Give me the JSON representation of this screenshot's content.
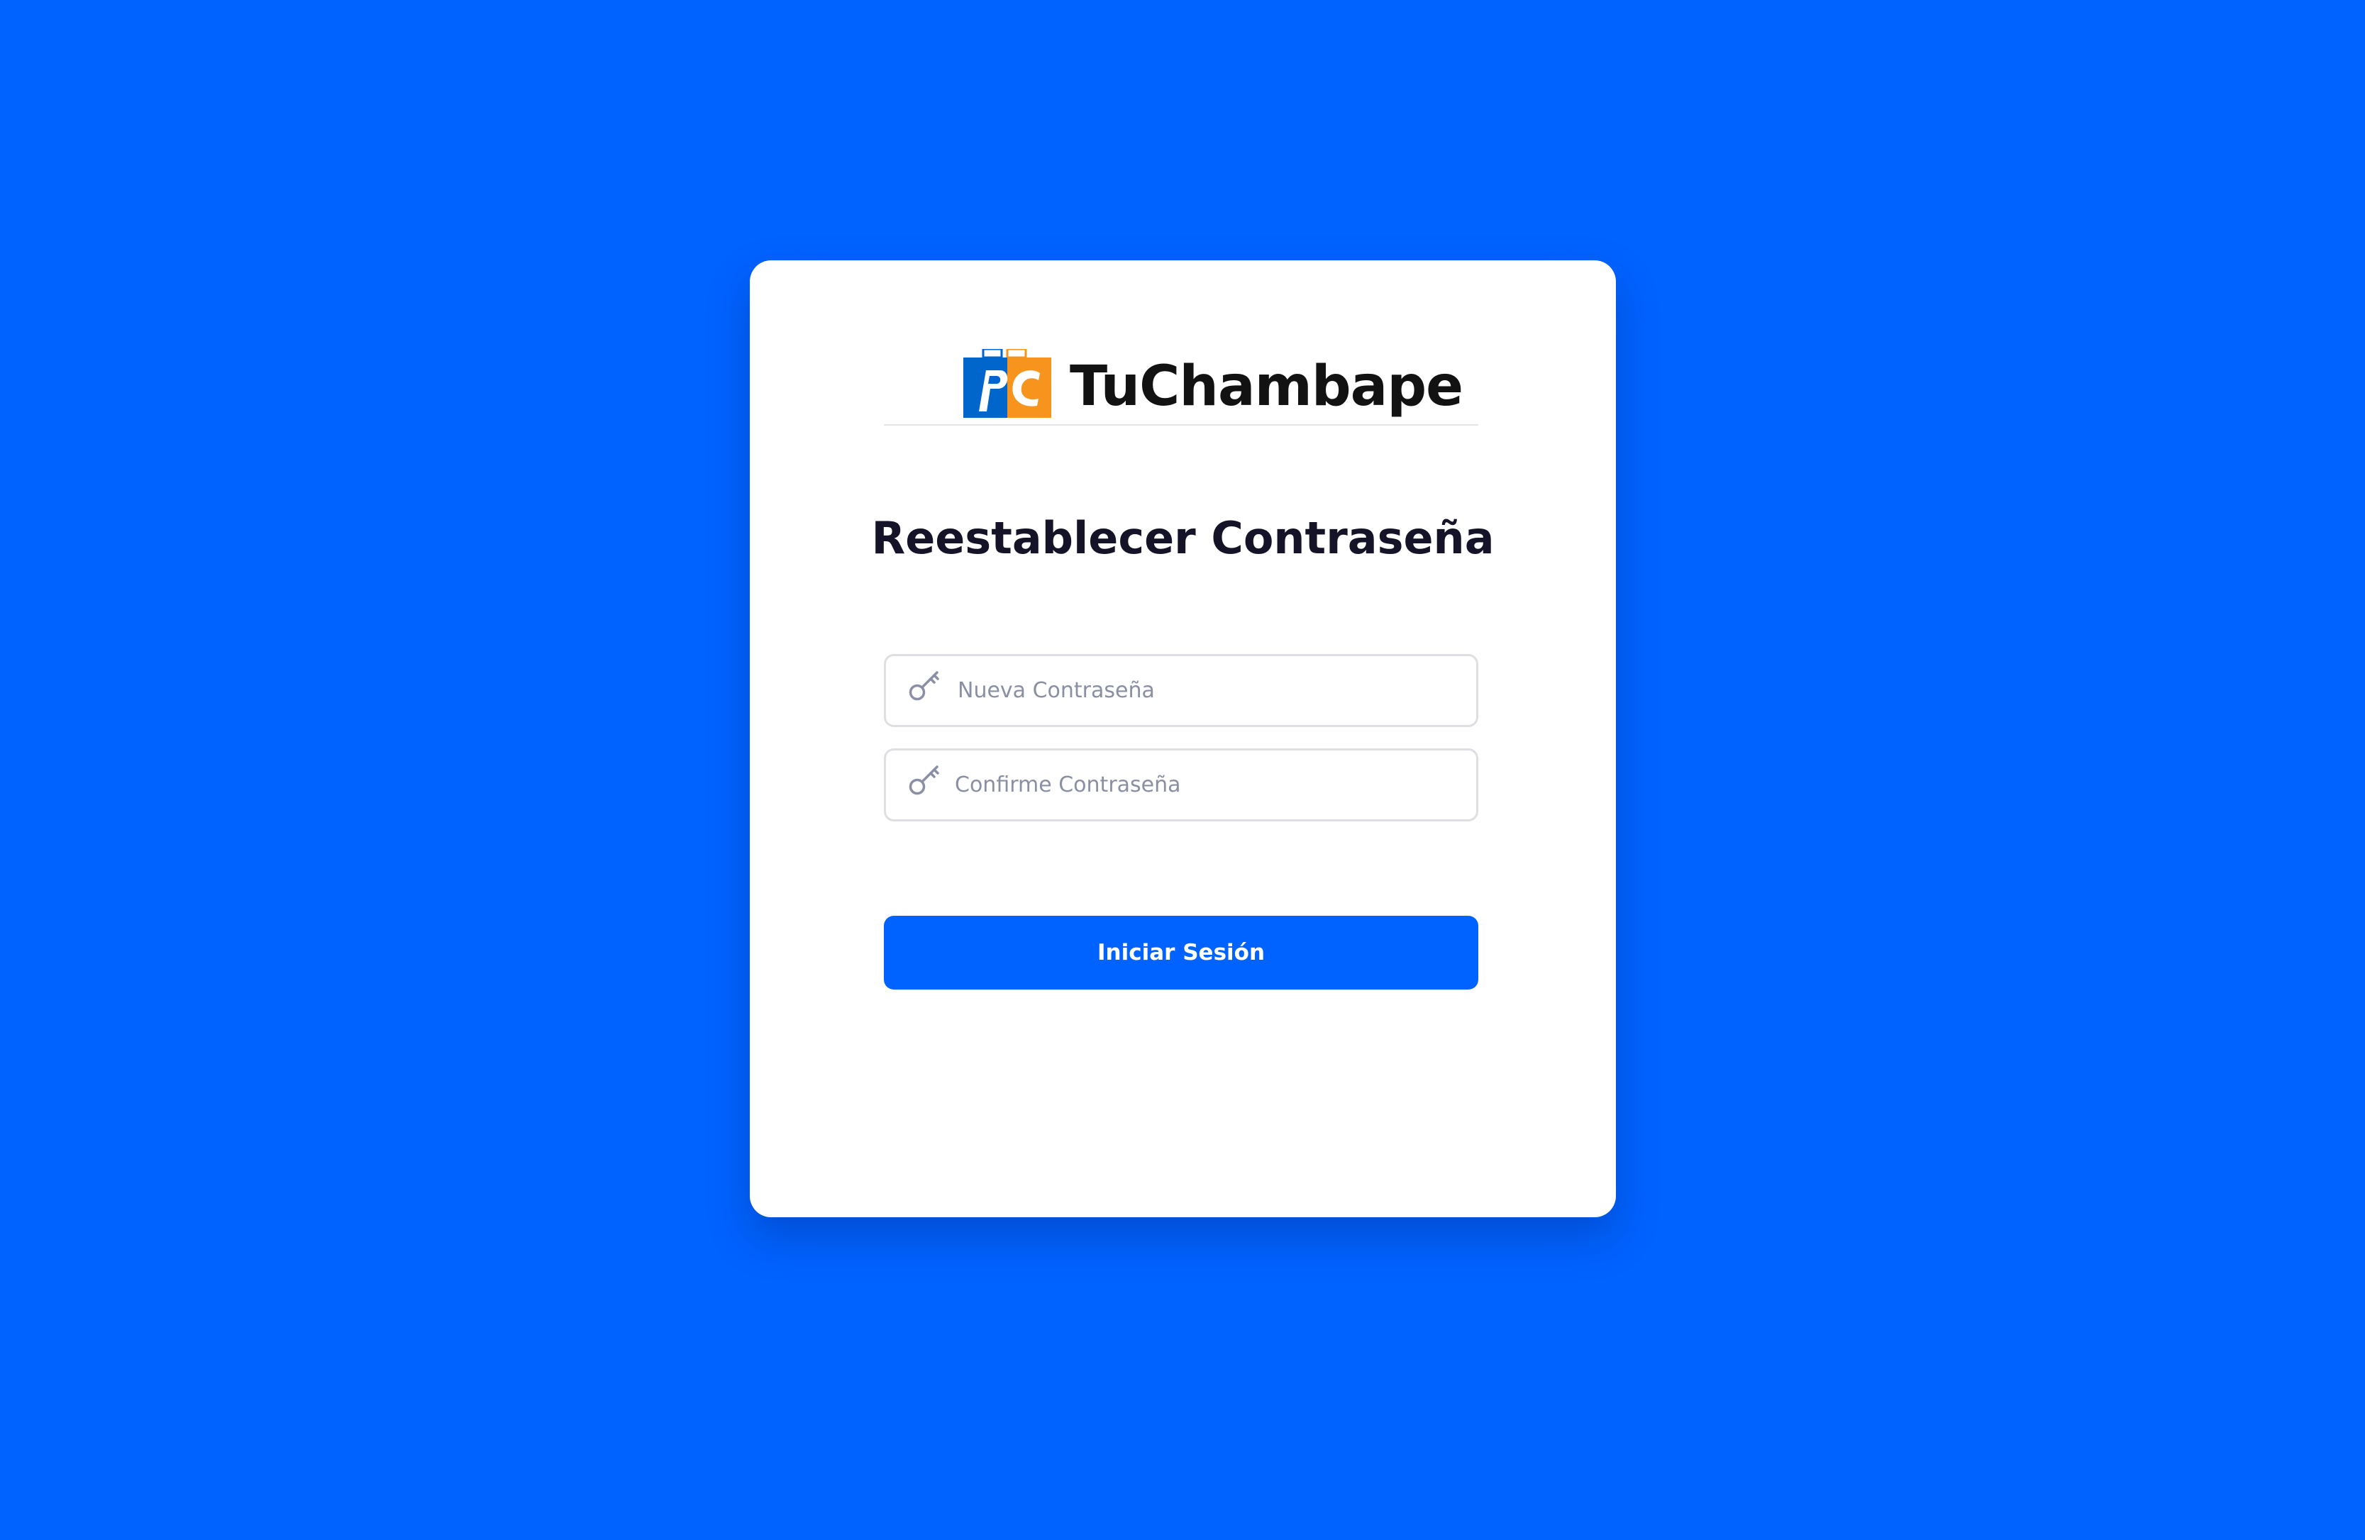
{
  "brand": {
    "name": "TuChambape",
    "logo_icon": "tuchambape-logo-icon",
    "logo_lettering": "PC"
  },
  "form": {
    "title": "Reestablecer Contraseña",
    "new_password": {
      "placeholder": "Nueva Contraseña",
      "icon": "key-icon"
    },
    "confirm_password": {
      "placeholder": "Confirme Contraseña",
      "icon": "key-icon"
    },
    "submit_label": "Iniciar Sesión"
  },
  "colors": {
    "background": "#0063FF",
    "card": "#FFFFFF",
    "button": "#0063FF",
    "logo_blue": "#0066CC",
    "logo_orange": "#F7941D",
    "title_text": "#141327",
    "placeholder_text": "#8A8FA4"
  }
}
